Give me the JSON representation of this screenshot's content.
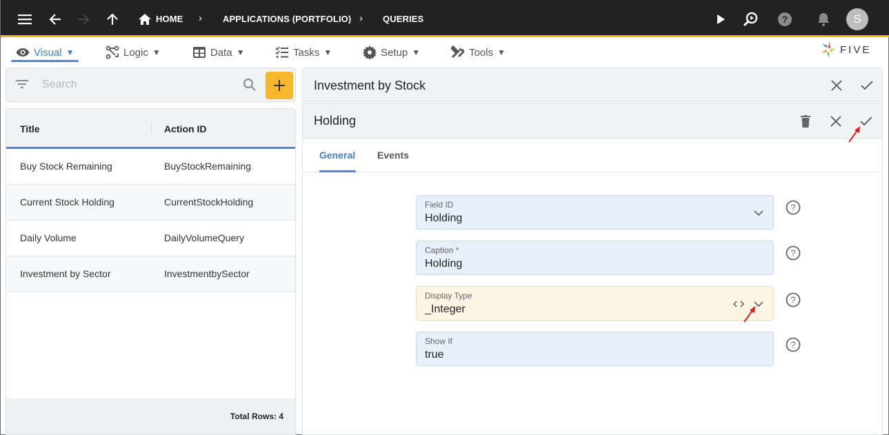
{
  "topbar": {
    "breadcrumbs": [
      "HOME",
      "APPLICATIONS (PORTFOLIO)",
      "QUERIES"
    ],
    "avatar_letter": "S",
    "accent_color": "#f3b528"
  },
  "menubar": {
    "items": [
      {
        "label": "Visual",
        "icon": "eye-icon",
        "active": true
      },
      {
        "label": "Logic",
        "icon": "logic-icon",
        "active": false
      },
      {
        "label": "Data",
        "icon": "table-icon",
        "active": false
      },
      {
        "label": "Tasks",
        "icon": "tasks-icon",
        "active": false
      },
      {
        "label": "Setup",
        "icon": "gear-icon",
        "active": false
      },
      {
        "label": "Tools",
        "icon": "tools-icon",
        "active": false
      }
    ],
    "caret": "▼",
    "logo_text": "FIVE"
  },
  "search": {
    "placeholder": "Search",
    "value": ""
  },
  "list": {
    "columns": [
      "Title",
      "Action ID"
    ],
    "rows": [
      {
        "title": "Buy Stock Remaining",
        "action_id": "BuyStockRemaining"
      },
      {
        "title": "Current Stock Holding",
        "action_id": "CurrentStockHolding"
      },
      {
        "title": "Daily Volume",
        "action_id": "DailyVolumeQuery"
      },
      {
        "title": "Investment by Sector",
        "action_id": "InvestmentbySector"
      }
    ],
    "total_rows": "Total Rows: 4"
  },
  "form": {
    "parent_title": "Investment by Stock",
    "title": "Holding",
    "tabs": [
      {
        "label": "General",
        "active": true
      },
      {
        "label": "Events",
        "active": false
      }
    ],
    "fields": [
      {
        "label": "Field ID",
        "value": "Holding",
        "type": "select"
      },
      {
        "label": "Caption *",
        "value": "Holding",
        "type": "text"
      },
      {
        "label": "Display Type",
        "value": "_Integer",
        "type": "select-code"
      },
      {
        "label": "Show If",
        "value": "true",
        "type": "text"
      }
    ]
  },
  "colors": {
    "primary": "#4a86d8",
    "add_button": "#f6b72c",
    "field_bg": "#e6f0fb",
    "field_warn_bg": "#fdf4e3"
  }
}
